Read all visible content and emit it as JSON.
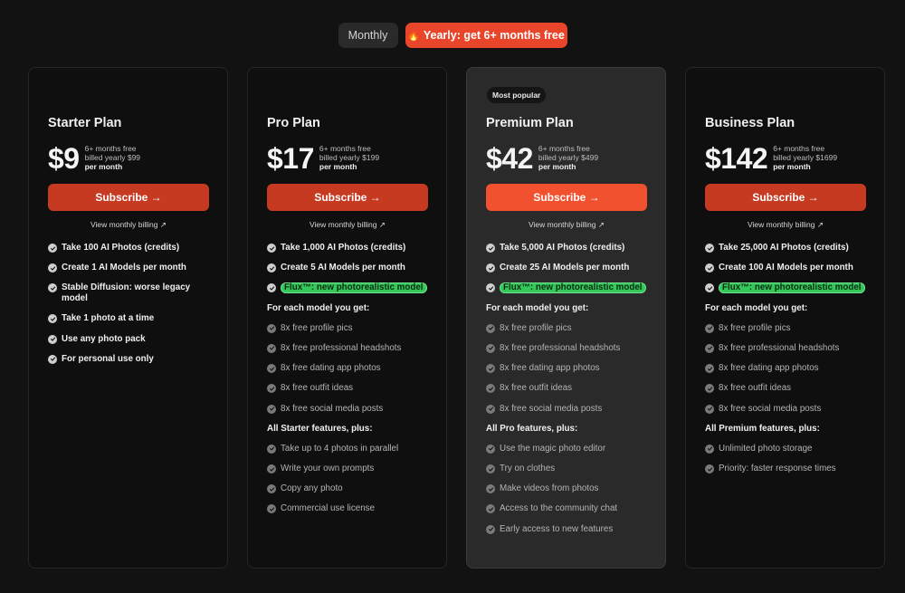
{
  "toggle": {
    "monthly_label": "Monthly",
    "yearly_icon": "fire-icon",
    "yearly_label": "Yearly: get 6+ months free"
  },
  "colors": {
    "accent": "#e8452a",
    "subscribe": "#c63a22",
    "subscribe_featured": "#f2512f",
    "flux_highlight": "#34c759"
  },
  "plans": [
    {
      "name": "Starter Plan",
      "badge": "",
      "price": "$9",
      "free_note": "6+ months free",
      "billed": "billed yearly $99",
      "per": "per month",
      "subscribe": "Subscribe →",
      "monthly_link": "View monthly billing ↗",
      "features": [
        {
          "kind": "strong",
          "text": "Take 100 AI Photos (credits)"
        },
        {
          "kind": "strong",
          "text": "Create 1 AI Models per month"
        },
        {
          "kind": "strong",
          "text": "Stable Diffusion: worse legacy model"
        },
        {
          "kind": "strong",
          "text": "Take 1 photo at a time"
        },
        {
          "kind": "strong",
          "text": "Use any photo pack"
        },
        {
          "kind": "strong",
          "text": "For personal use only"
        }
      ]
    },
    {
      "name": "Pro Plan",
      "badge": "",
      "price": "$17",
      "free_note": "6+ months free",
      "billed": "billed yearly $199",
      "per": "per month",
      "subscribe": "Subscribe →",
      "monthly_link": "View monthly billing ↗",
      "features": [
        {
          "kind": "strong",
          "text": "Take 1,000 AI Photos (credits)"
        },
        {
          "kind": "strong",
          "text": "Create 5 AI Models per month"
        },
        {
          "kind": "flux",
          "text": "Flux™: new photorealistic model"
        },
        {
          "kind": "head",
          "text": "For each model you get:"
        },
        {
          "kind": "dim",
          "text": "8x free profile pics"
        },
        {
          "kind": "dim",
          "text": "8x free professional headshots"
        },
        {
          "kind": "dim",
          "text": "8x free dating app photos"
        },
        {
          "kind": "dim",
          "text": "8x free outfit ideas"
        },
        {
          "kind": "dim",
          "text": "8x free social media posts"
        },
        {
          "kind": "head",
          "text": "All Starter features, plus:"
        },
        {
          "kind": "dim",
          "text": "Take up to 4 photos in parallel"
        },
        {
          "kind": "dim",
          "text": "Write your own prompts"
        },
        {
          "kind": "dim",
          "text": "Copy any photo"
        },
        {
          "kind": "dim",
          "text": "Commercial use license"
        }
      ]
    },
    {
      "name": "Premium Plan",
      "badge": "Most popular",
      "price": "$42",
      "free_note": "6+ months free",
      "billed": "billed yearly $499",
      "per": "per month",
      "subscribe": "Subscribe →",
      "monthly_link": "View monthly billing ↗",
      "features": [
        {
          "kind": "strong",
          "text": "Take 5,000 AI Photos (credits)"
        },
        {
          "kind": "strong",
          "text": "Create 25 AI Models per month"
        },
        {
          "kind": "flux",
          "text": "Flux™: new photorealistic model"
        },
        {
          "kind": "head",
          "text": "For each model you get:"
        },
        {
          "kind": "dim",
          "text": "8x free profile pics"
        },
        {
          "kind": "dim",
          "text": "8x free professional headshots"
        },
        {
          "kind": "dim",
          "text": "8x free dating app photos"
        },
        {
          "kind": "dim",
          "text": "8x free outfit ideas"
        },
        {
          "kind": "dim",
          "text": "8x free social media posts"
        },
        {
          "kind": "head",
          "text": "All Pro features, plus:"
        },
        {
          "kind": "dim",
          "text": "Use the magic photo editor"
        },
        {
          "kind": "dim",
          "text": "Try on clothes"
        },
        {
          "kind": "dim",
          "text": "Make videos from photos"
        },
        {
          "kind": "dim",
          "text": "Access to the community chat"
        },
        {
          "kind": "dim",
          "text": "Early access to new features"
        }
      ]
    },
    {
      "name": "Business Plan",
      "badge": "",
      "price": "$142",
      "free_note": "6+ months free",
      "billed": "billed yearly $1699",
      "per": "per month",
      "subscribe": "Subscribe →",
      "monthly_link": "View monthly billing ↗",
      "features": [
        {
          "kind": "strong",
          "text": "Take 25,000 AI Photos (credits)"
        },
        {
          "kind": "strong",
          "text": "Create 100 AI Models per month"
        },
        {
          "kind": "flux",
          "text": "Flux™: new photorealistic model"
        },
        {
          "kind": "head",
          "text": "For each model you get:"
        },
        {
          "kind": "dim",
          "text": "8x free profile pics"
        },
        {
          "kind": "dim",
          "text": "8x free professional headshots"
        },
        {
          "kind": "dim",
          "text": "8x free dating app photos"
        },
        {
          "kind": "dim",
          "text": "8x free outfit ideas"
        },
        {
          "kind": "dim",
          "text": "8x free social media posts"
        },
        {
          "kind": "head",
          "text": "All Premium features, plus:"
        },
        {
          "kind": "dim",
          "text": "Unlimited photo storage"
        },
        {
          "kind": "dim",
          "text": "Priority: faster response times"
        }
      ]
    }
  ]
}
